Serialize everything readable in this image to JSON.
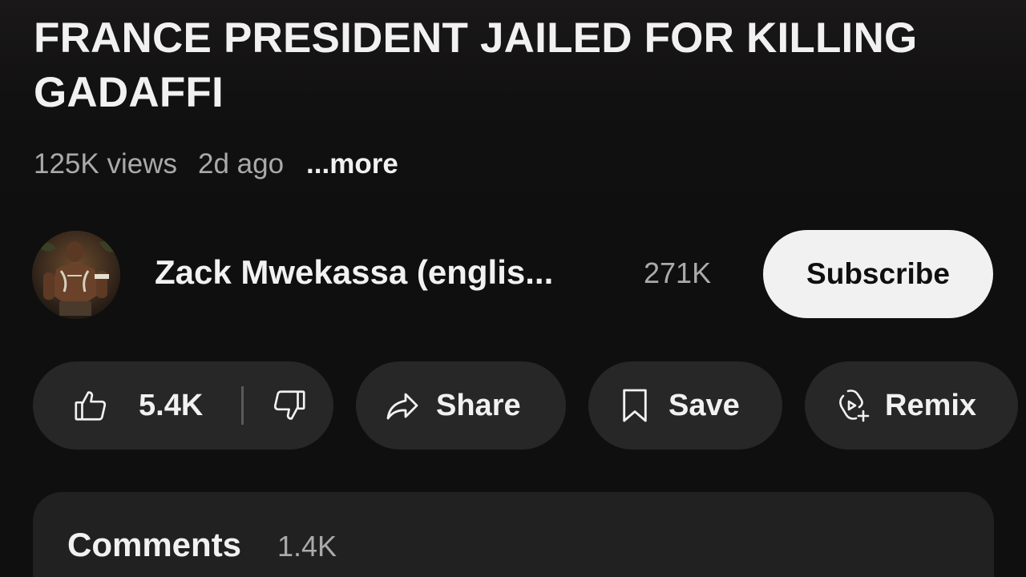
{
  "video": {
    "title": "FRANCE PRESIDENT JAILED FOR KILLING GADAFFI",
    "views": "125K views",
    "age": "2d ago",
    "more_label": "...more"
  },
  "channel": {
    "name": "Zack Mwekassa (englis...",
    "subscribers": "271K",
    "subscribe_label": "Subscribe",
    "avatar_icon": "channel-avatar"
  },
  "actions": {
    "like_count": "5.4K",
    "like_icon": "thumbs-up-icon",
    "dislike_icon": "thumbs-down-icon",
    "share_label": "Share",
    "share_icon": "share-arrow-icon",
    "save_label": "Save",
    "save_icon": "bookmark-icon",
    "remix_label": "Remix",
    "remix_icon": "remix-icon"
  },
  "comments": {
    "title": "Comments",
    "count": "1.4K"
  },
  "colors": {
    "background": "#0f0f0f",
    "pill": "#272727",
    "comments_panel": "#212121",
    "subscribe_bg": "#f1f1f1",
    "primary_text": "#f1f1f1",
    "secondary_text": "#aaaaaa"
  }
}
